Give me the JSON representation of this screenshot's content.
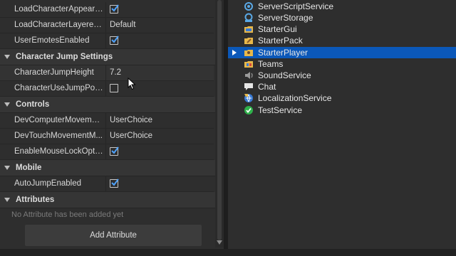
{
  "properties": {
    "rows_top": [
      {
        "name": "LoadCharacterAppeara...",
        "type": "checkbox",
        "checked": true
      },
      {
        "name": "LoadCharacterLayered...",
        "type": "text",
        "value": "Default"
      },
      {
        "name": "UserEmotesEnabled",
        "type": "checkbox",
        "checked": true
      }
    ],
    "sections": [
      {
        "title": "Character Jump Settings"
      },
      {
        "title": "Controls"
      },
      {
        "title": "Mobile"
      },
      {
        "title": "Attributes"
      }
    ],
    "jump_rows": [
      {
        "name": "CharacterJumpHeight",
        "type": "text",
        "value": "7.2"
      },
      {
        "name": "CharacterUseJumpPower",
        "type": "checkbox",
        "checked": false
      }
    ],
    "control_rows": [
      {
        "name": "DevComputerMovemen...",
        "type": "text",
        "value": "UserChoice"
      },
      {
        "name": "DevTouchMovementM...",
        "type": "text",
        "value": "UserChoice"
      },
      {
        "name": "EnableMouseLockOption",
        "type": "checkbox",
        "checked": true
      }
    ],
    "mobile_rows": [
      {
        "name": "AutoJumpEnabled",
        "type": "checkbox",
        "checked": true
      }
    ],
    "attributes": {
      "empty_note": "No Attribute has been added yet",
      "add_label": "Add Attribute"
    }
  },
  "explorer": {
    "items": [
      {
        "label": "ServerScriptService",
        "icon": "server-script-service-icon"
      },
      {
        "label": "ServerStorage",
        "icon": "server-storage-icon"
      },
      {
        "label": "StarterGui",
        "icon": "starter-gui-icon"
      },
      {
        "label": "StarterPack",
        "icon": "starter-pack-icon"
      },
      {
        "label": "StarterPlayer",
        "icon": "starter-player-icon",
        "selected": true
      },
      {
        "label": "Teams",
        "icon": "teams-icon"
      },
      {
        "label": "SoundService",
        "icon": "sound-service-icon"
      },
      {
        "label": "Chat",
        "icon": "chat-icon"
      },
      {
        "label": "LocalizationService",
        "icon": "localization-service-icon"
      },
      {
        "label": "TestService",
        "icon": "test-service-icon"
      }
    ]
  },
  "colors": {
    "selection": "#0b58b9",
    "checkmark": "#4fa3ff",
    "panel": "#2e2e2e"
  }
}
